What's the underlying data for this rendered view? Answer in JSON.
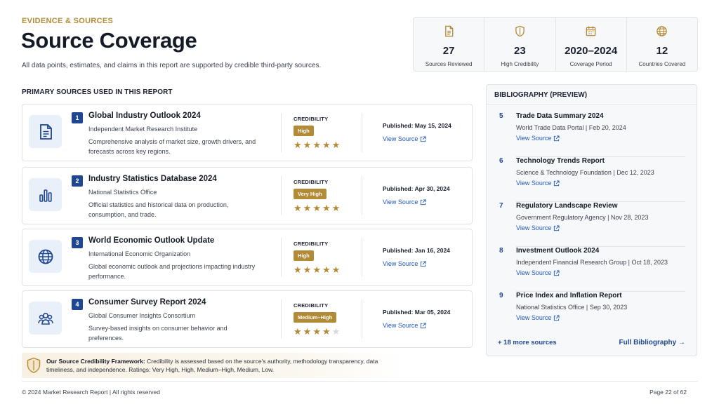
{
  "header": {
    "eyebrow": "EVIDENCE & SOURCES",
    "title": "Source Coverage",
    "subtitle": "All data points, estimates, and claims in this report are supported by credible third-party sources."
  },
  "stats": [
    {
      "icon": "document-icon",
      "value": "27",
      "label": "Sources Reviewed"
    },
    {
      "icon": "shield-icon",
      "value": "23",
      "label": "High Credibility"
    },
    {
      "icon": "calendar-icon",
      "value": "2020–2024",
      "label": "Coverage Period"
    },
    {
      "icon": "globe-icon",
      "value": "12",
      "label": "Countries Covered"
    }
  ],
  "primary": {
    "heading": "PRIMARY SOURCES USED IN THIS REPORT",
    "credibility_label": "CREDIBILITY",
    "view_label": "View Source",
    "sources": [
      {
        "num": "1",
        "icon": "document-icon",
        "title": "Global Industry Outlook 2024",
        "org": "Independent Market Research Institute",
        "desc": "Comprehensive analysis of market size, growth drivers, and forecasts across key regions.",
        "credibility": "High",
        "stars": 5,
        "published": "Published: May 15, 2024"
      },
      {
        "num": "2",
        "icon": "bar-chart-icon",
        "title": "Industry Statistics Database 2024",
        "org": "National Statistics Office",
        "desc": "Official statistics and historical data on production, consumption, and trade.",
        "credibility": "Very High",
        "stars": 5,
        "published": "Published: Apr 30, 2024"
      },
      {
        "num": "3",
        "icon": "globe-icon",
        "title": "World Economic Outlook Update",
        "org": "International Economic Organization",
        "desc": "Global economic outlook and projections impacting industry performance.",
        "credibility": "High",
        "stars": 5,
        "published": "Published: Jan 16, 2024"
      },
      {
        "num": "4",
        "icon": "users-icon",
        "title": "Consumer Survey Report 2024",
        "org": "Global Consumer Insights Consortium",
        "desc": "Survey-based insights on consumer behavior and preferences.",
        "credibility": "Medium–High",
        "stars": 4,
        "published": "Published: Mar 05, 2024"
      }
    ]
  },
  "framework": {
    "bold": "Our Source Credibility Framework:",
    "text": " Credibility is assessed based on the source's authority, methodology transparency, data timeliness, and independence. Ratings: Very High, High, Medium–High, Medium, Low."
  },
  "bibliography": {
    "heading": "BIBLIOGRAPHY (PREVIEW)",
    "view_label": "View Source",
    "items": [
      {
        "num": "5",
        "title": "Trade Data Summary 2024",
        "meta": "World Trade Data Portal  |  Feb 20, 2024"
      },
      {
        "num": "6",
        "title": "Technology Trends Report",
        "meta": "Science & Technology Foundation  |  Dec 12, 2023"
      },
      {
        "num": "7",
        "title": "Regulatory Landscape Review",
        "meta": "Government Regulatory Agency  |  Nov 28, 2023"
      },
      {
        "num": "8",
        "title": "Investment Outlook 2024",
        "meta": "Independent Financial Research Group  |  Oct 18, 2023"
      },
      {
        "num": "9",
        "title": "Price Index and Inflation Report",
        "meta": "National Statistics Office  |  Sep 30, 2023"
      }
    ],
    "more_label": "+ 18 more sources",
    "full_label": "Full Bibliography →"
  },
  "footer": {
    "left": "© 2024 Market Research Report  |  All rights reserved",
    "right": "Page 22 of 62"
  },
  "colors": {
    "accent_gold": "#b38a35",
    "navy": "#1f4690",
    "link_blue": "#1f56b8"
  }
}
